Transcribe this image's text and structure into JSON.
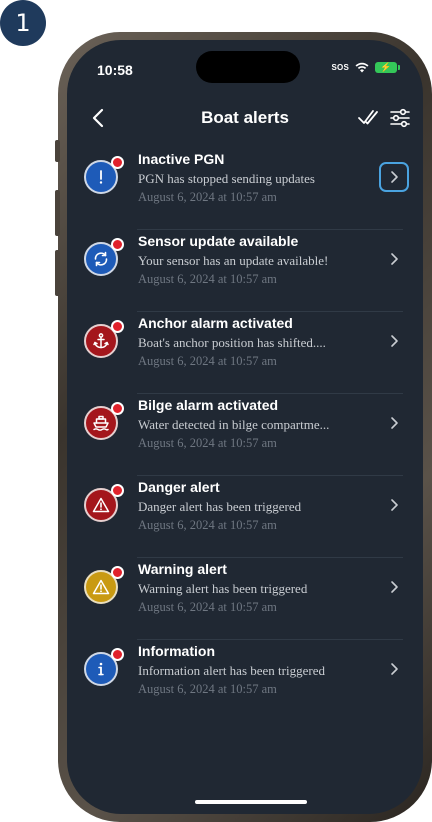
{
  "step": "1",
  "status": {
    "time": "10:58",
    "sos": "SOS"
  },
  "header": {
    "title": "Boat alerts"
  },
  "alerts": [
    {
      "title": "Inactive PGN",
      "message": "PGN  has stopped sending updates",
      "date": "August 6, 2024 at 10:57 am",
      "icon": "exclamation-icon",
      "color": "#1e5bb8"
    },
    {
      "title": "Sensor update available",
      "message": "Your sensor has an update available!",
      "date": "August 6, 2024 at 10:57 am",
      "icon": "sync-icon",
      "color": "#1e5bb8"
    },
    {
      "title": "Anchor alarm activated",
      "message": "Boat's anchor position has shifted....",
      "date": "August 6, 2024 at 10:57 am",
      "icon": "anchor-icon",
      "color": "#a4161c"
    },
    {
      "title": "Bilge alarm activated",
      "message": "Water detected in bilge compartme...",
      "date": "August 6, 2024 at 10:57 am",
      "icon": "boat-icon",
      "color": "#a4161c"
    },
    {
      "title": "Danger alert",
      "message": "Danger alert has been triggered",
      "date": "August 6, 2024 at 10:57 am",
      "icon": "warning-triangle-icon",
      "color": "#a4161c"
    },
    {
      "title": "Warning alert",
      "message": "Warning alert has been triggered",
      "date": "August 6, 2024 at 10:57 am",
      "icon": "warning-triangle-icon",
      "color": "#c99a12"
    },
    {
      "title": "Information",
      "message": "Information alert has been triggered",
      "date": "August 6, 2024 at 10:57 am",
      "icon": "info-icon",
      "color": "#1e5bb8"
    }
  ],
  "colors": {
    "screen_bg": "#202833",
    "unread_dot": "#e0212b",
    "focus_ring": "#4aa3e0"
  }
}
